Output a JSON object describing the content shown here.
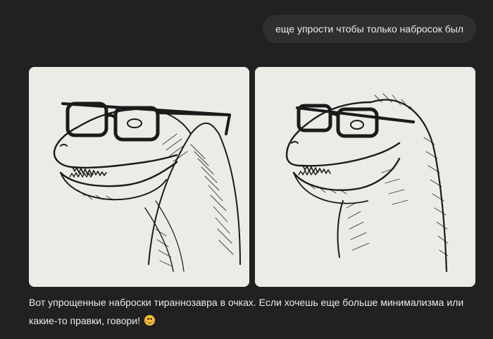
{
  "conversation": {
    "user_message": "еще упрости чтобы только набросок был",
    "images": [
      {
        "alt": "Набросок тираннозавра в очках 1"
      },
      {
        "alt": "Набросок тираннозавра в очках 2"
      }
    ],
    "assistant_message": "Вот упрощенные наброски тираннозавра в очках. Если хочешь еще больше минимализма или какие-то правки, говори!",
    "emoji": "smiling-face-icon"
  },
  "colors": {
    "background": "#212121",
    "bubble": "#2f2f2f",
    "text": "#ececec",
    "image_bg": "#ecebe6"
  }
}
